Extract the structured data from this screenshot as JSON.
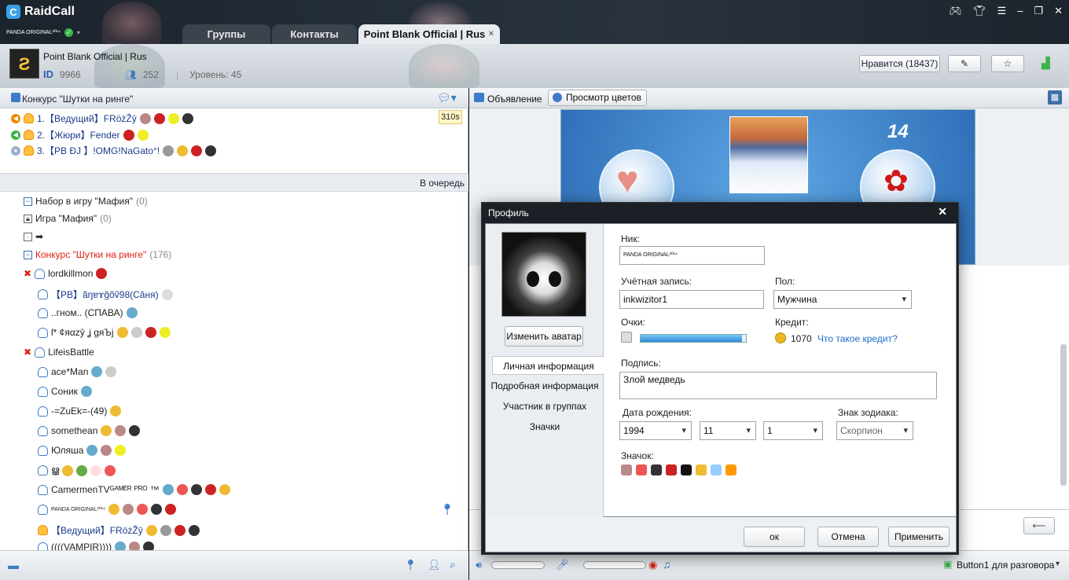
{
  "app": {
    "name": "RaidCall",
    "user": "PANDA ORIGINAL²º¹⁴"
  },
  "tabs": [
    {
      "label": "Группы"
    },
    {
      "label": "Контакты"
    },
    {
      "label": "Point Blank Official | Rus",
      "close": "×"
    }
  ],
  "channel": {
    "name": "Point Blank Official | Rus",
    "id_label": "ID",
    "id": "9966",
    "members": "252",
    "level": "Уровень: 45",
    "like_button": "Нравится (18437)"
  },
  "queue": {
    "title": "Конкурс \"Шутки на ринге\"",
    "timer": "310s",
    "enqueue": "В очередь",
    "rows": [
      {
        "label": "1.【Ведущий】FRöżŽŷ"
      },
      {
        "label": "2.【Жюри】Fender"
      },
      {
        "label": "3.【PB ÐJ 】!OMG!NaGato°!"
      }
    ]
  },
  "tree": [
    {
      "label": "Набор в игру \"Мафия\"",
      "count": "(0)"
    },
    {
      "label": "Игра \"Мафия\"",
      "count": "(0)"
    },
    {
      "label": "➡",
      "count": ""
    },
    {
      "label": "Конкурс \"Шутки на ринге\"",
      "count": "(176)"
    },
    {
      "label": "lordkillmon"
    },
    {
      "label": "【PB】ãŋɐɤğõṽ98(Câня)"
    },
    {
      "label": "..гном.. (СПАВА)"
    },
    {
      "label": "ſ*  ¢яαzŷ  ʝ gяЪj"
    },
    {
      "label": "LifeisBattle"
    },
    {
      "label": "ace*Man"
    },
    {
      "label": "Соник"
    },
    {
      "label": "-=ZuEk=-(49)"
    },
    {
      "label": "somethean"
    },
    {
      "label": "Юляша"
    },
    {
      "label": "ൠ"
    },
    {
      "label": "CamermenTVᴳᴬᴹᴱᴿ ᴾᴿᴼ ™"
    },
    {
      "label": "PANDA ORIGINAL²º¹⁴"
    },
    {
      "label": "【Ведущий】FRöżŽŷ"
    },
    {
      "label": "((((VAMPIR))))"
    }
  ],
  "right": {
    "announcement": "Объявление",
    "flowers": "Просмотр цветов",
    "gift_count": "14",
    "voice_hint": "Button1 для разговора"
  },
  "dialog": {
    "title": "Профиль",
    "change_avatar": "Изменить аватар",
    "nav": [
      "Личная информация",
      "Подробная информация",
      "Участник в группах",
      "Значки"
    ],
    "nick_label": "Ник:",
    "nick": "PANDA ORIGINAL²º¹⁴",
    "account_label": "Учётная запись:",
    "account": "inkwizitor1",
    "gender_label": "Пол:",
    "gender": "Мужчина",
    "points_label": "Очки:",
    "points_progress": 0.96,
    "credit_label": "Кредит:",
    "credit": "1070",
    "credit_link": "Что такое кредит?",
    "signature_label": "Подпись:",
    "signature": "Злой медведь",
    "birth_label": "Дата рождения:",
    "year": "1994",
    "month": "11",
    "day": "1",
    "zodiac_label": "Знак зодиака:",
    "zodiac": "Скорпион",
    "badges_label": "Значок:",
    "ok": "ок",
    "cancel": "Отмена",
    "apply": "Применить"
  },
  "colors": {
    "accent": "#3aa0e8",
    "titlebar": "#1b232c",
    "dialog_frame": "#1b2026",
    "link": "#1a6fc7"
  }
}
